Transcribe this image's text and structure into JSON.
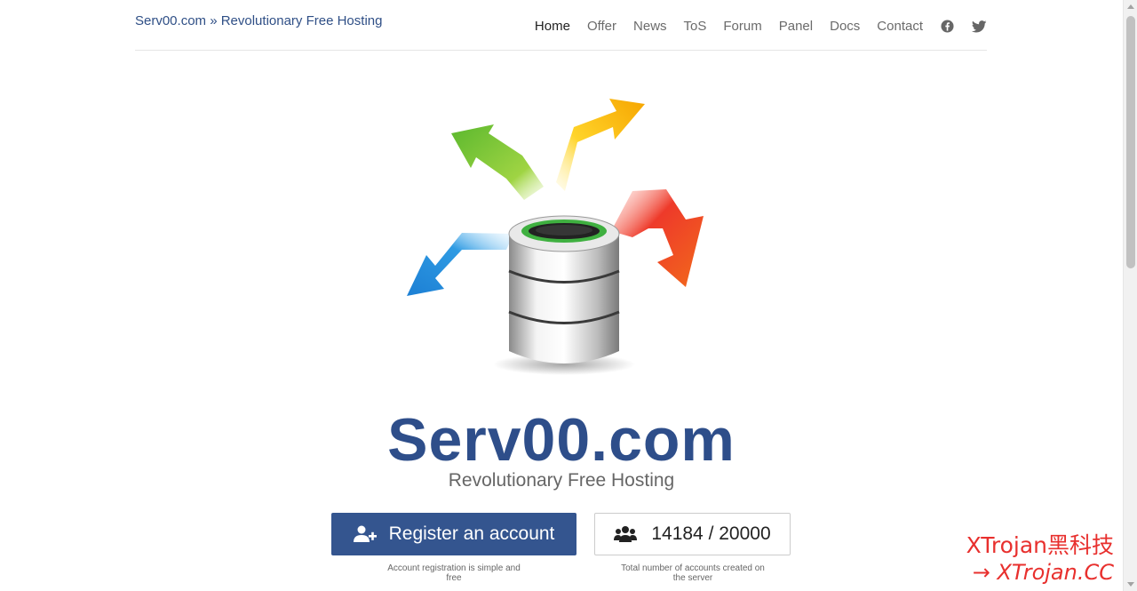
{
  "header": {
    "brand": "Serv00.com » Revolutionary Free Hosting",
    "nav": [
      {
        "label": "Home",
        "active": true
      },
      {
        "label": "Offer"
      },
      {
        "label": "News"
      },
      {
        "label": "ToS"
      },
      {
        "label": "Forum"
      },
      {
        "label": "Panel"
      },
      {
        "label": "Docs"
      },
      {
        "label": "Contact"
      }
    ],
    "social": [
      "facebook-icon",
      "twitter-icon"
    ]
  },
  "hero": {
    "title": "Serv00.com",
    "subtitle": "Revolutionary Free Hosting"
  },
  "actions": {
    "register_label": "Register an account",
    "register_note": "Account registration is simple and free",
    "accounts_count": "14184 / 20000",
    "accounts_note": "Total number of accounts created on the server"
  },
  "watermark": {
    "line1": "XTrojan黑科技",
    "line2": "→ XTrojan.CC"
  },
  "colors": {
    "brand_blue": "#2e4e8a",
    "button_blue": "#34558f",
    "watermark_red": "#e8302e"
  }
}
